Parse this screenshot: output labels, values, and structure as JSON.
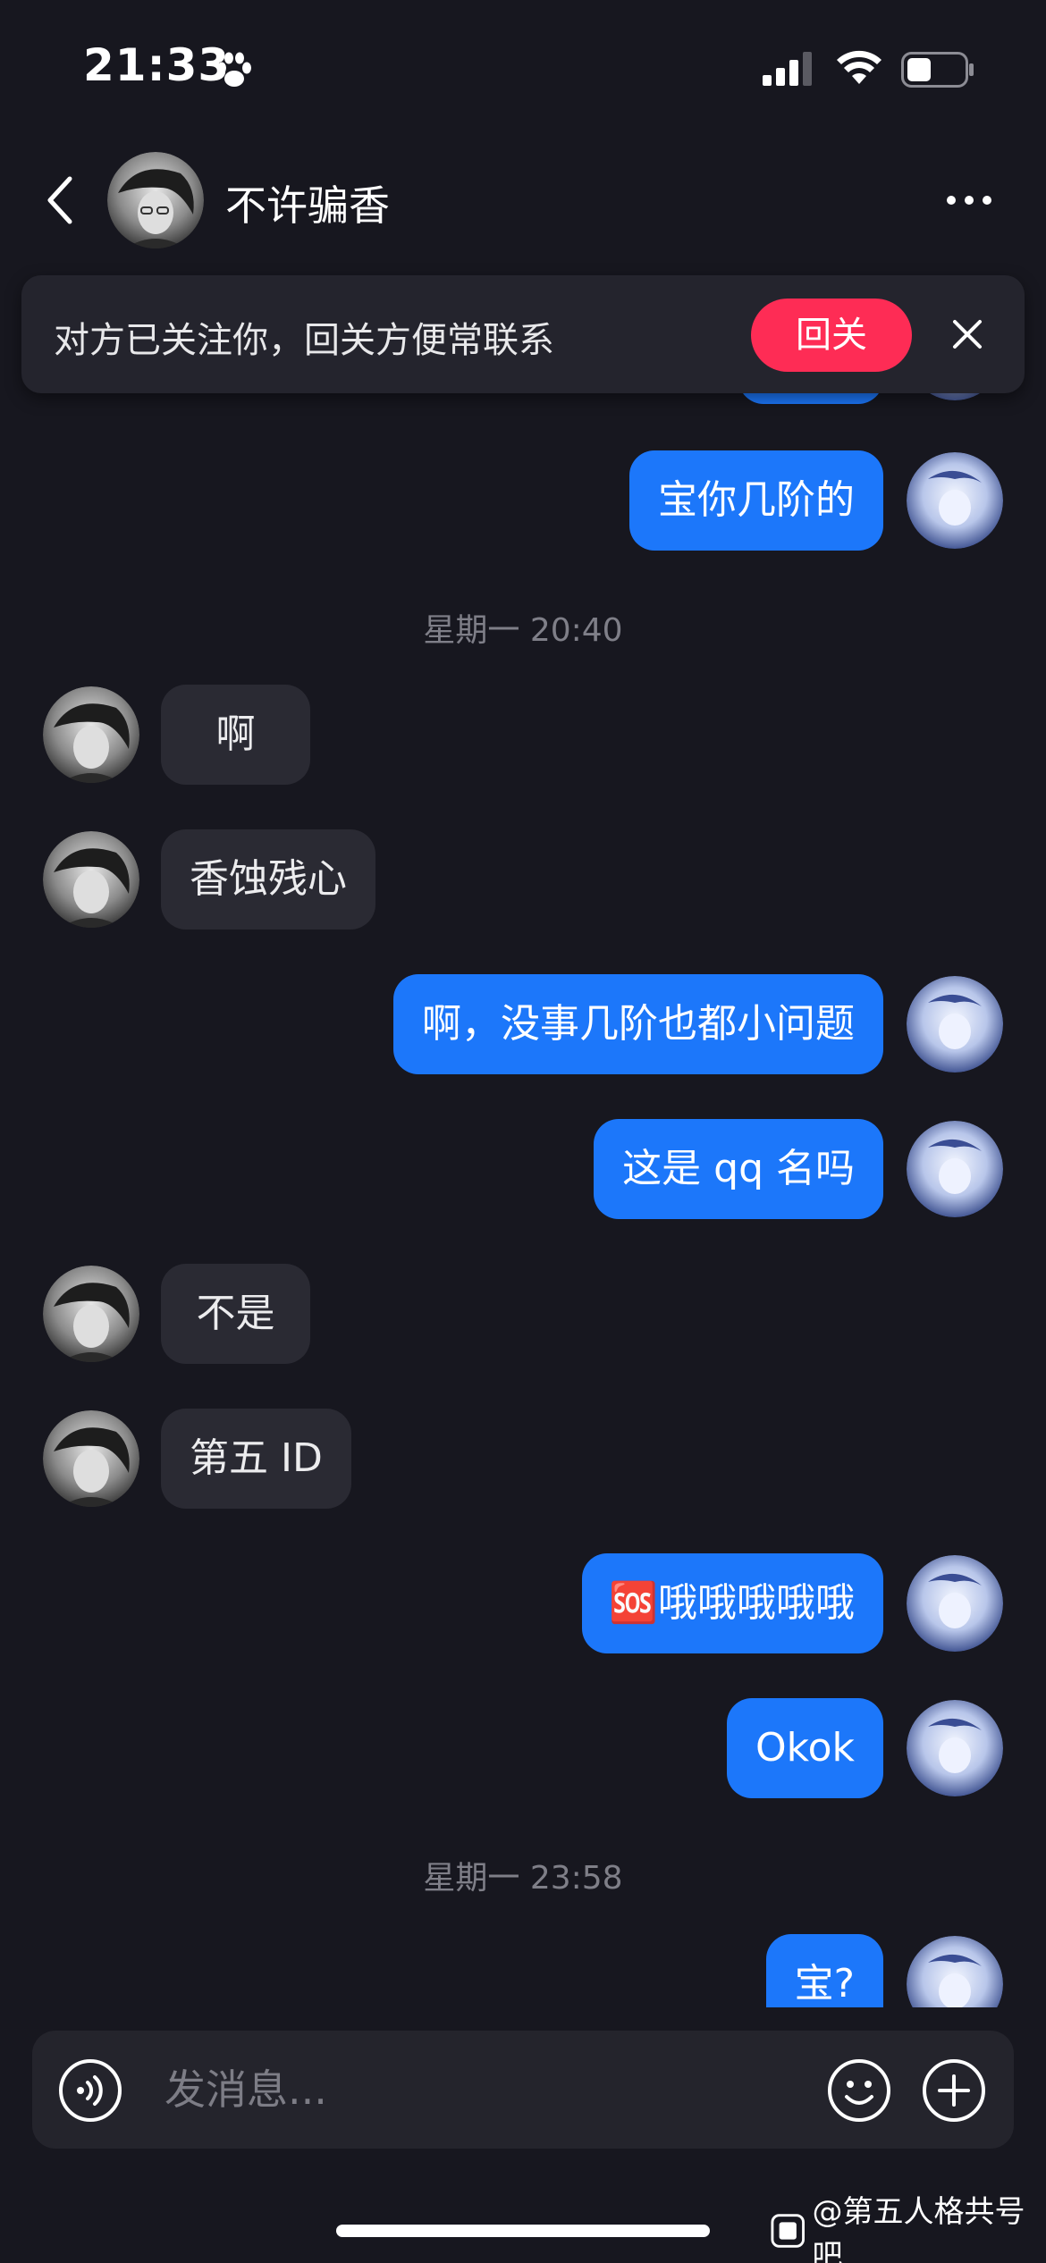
{
  "status_bar": {
    "time": "21:33"
  },
  "header": {
    "title": "不许骗香"
  },
  "banner": {
    "text": "对方已关注你，回关方便常联系",
    "button_label": "回关"
  },
  "timestamps": [
    "星期一 20:40",
    "星期一 23:58"
  ],
  "messages": [
    {
      "side": "out",
      "text": "宝你几阶的"
    },
    {
      "side": "in",
      "text": "啊"
    },
    {
      "side": "in",
      "text": "香蚀残心"
    },
    {
      "side": "out",
      "text": "啊，没事几阶也都小问题"
    },
    {
      "side": "out",
      "text": "这是 qq 名吗"
    },
    {
      "side": "in",
      "text": "不是"
    },
    {
      "side": "in",
      "text": "第五 ID"
    },
    {
      "side": "out",
      "text": "哦哦哦哦哦",
      "prefix_emoji": "🆘"
    },
    {
      "side": "out",
      "text": "Okok"
    },
    {
      "side": "out",
      "text": "宝?"
    }
  ],
  "input": {
    "placeholder": "发消息..."
  },
  "watermark": {
    "text": "@第五人格共号吧"
  },
  "colors": {
    "background": "#17171f",
    "outgoing_bubble": "#1c77fa",
    "incoming_bubble": "#2a2a33",
    "follow_button": "#fe2c55"
  }
}
